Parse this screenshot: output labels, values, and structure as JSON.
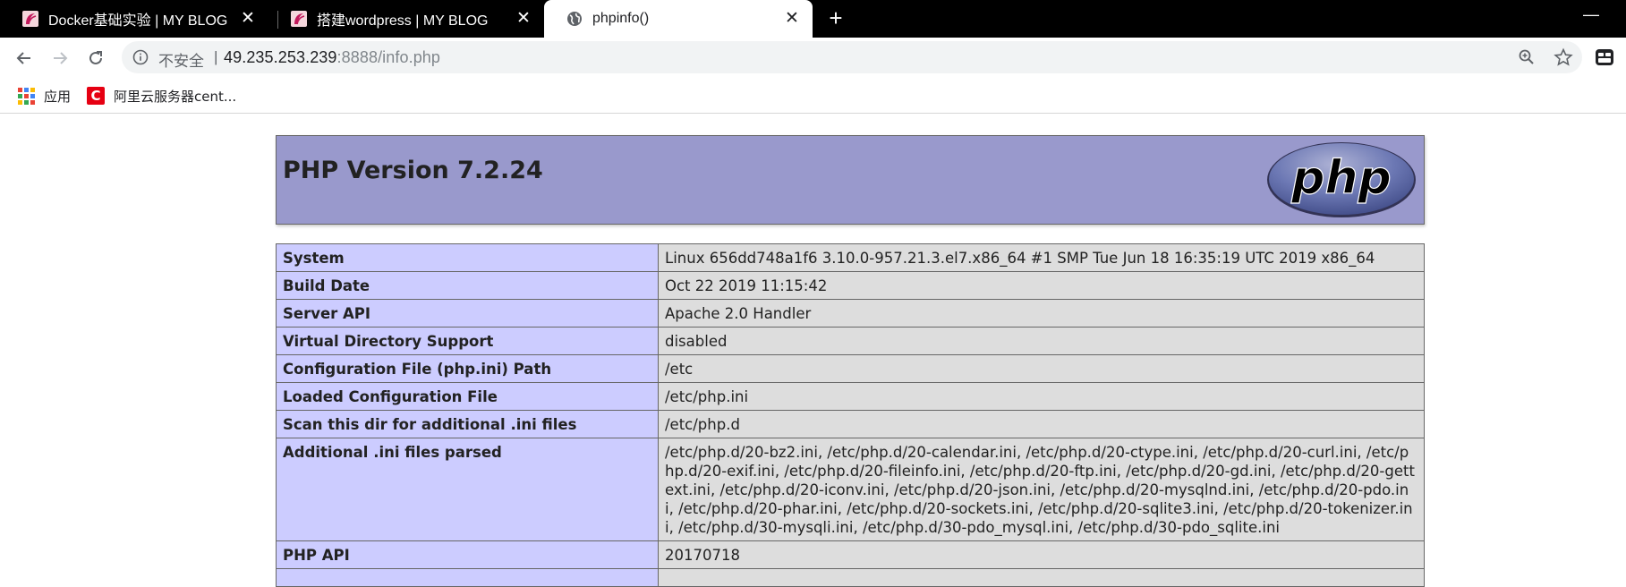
{
  "browser": {
    "tabs": [
      {
        "title": "Docker基础实验 | MY BLOG",
        "active": false,
        "icon": "blog-favicon"
      },
      {
        "title": "搭建wordpress | MY BLOG",
        "active": false,
        "icon": "blog-favicon"
      },
      {
        "title": "phpinfo()",
        "active": true,
        "icon": "globe-icon"
      }
    ],
    "new_tab_label": "+",
    "minimize_label": "—",
    "close_glyph": "✕"
  },
  "toolbar": {
    "security_label": "不安全",
    "separator": "|",
    "url_host": "49.235.253.239",
    "url_rest": ":8888/info.php"
  },
  "bookmarks": {
    "apps_label": "应用",
    "items": [
      {
        "label": "阿里云服务器cent...",
        "icon": "c-icon"
      }
    ]
  },
  "phpinfo": {
    "title": "PHP Version 7.2.24",
    "logo_text": "php",
    "rows": [
      {
        "key": "System",
        "value": "Linux 656dd748a1f6 3.10.0-957.21.3.el7.x86_64 #1 SMP Tue Jun 18 16:35:19 UTC 2019 x86_64"
      },
      {
        "key": "Build Date",
        "value": "Oct 22 2019 11:15:42"
      },
      {
        "key": "Server API",
        "value": "Apache 2.0 Handler"
      },
      {
        "key": "Virtual Directory Support",
        "value": "disabled"
      },
      {
        "key": "Configuration File (php.ini) Path",
        "value": "/etc"
      },
      {
        "key": "Loaded Configuration File",
        "value": "/etc/php.ini"
      },
      {
        "key": "Scan this dir for additional .ini files",
        "value": "/etc/php.d"
      },
      {
        "key": "Additional .ini files parsed",
        "value": "/etc/php.d/20-bz2.ini, /etc/php.d/20-calendar.ini, /etc/php.d/20-ctype.ini, /etc/php.d/20-curl.ini, /etc/php.d/20-exif.ini, /etc/php.d/20-fileinfo.ini, /etc/php.d/20-ftp.ini, /etc/php.d/20-gd.ini, /etc/php.d/20-gettext.ini, /etc/php.d/20-iconv.ini, /etc/php.d/20-json.ini, /etc/php.d/20-mysqlnd.ini, /etc/php.d/20-pdo.ini, /etc/php.d/20-phar.ini, /etc/php.d/20-sockets.ini, /etc/php.d/20-sqlite3.ini, /etc/php.d/20-tokenizer.ini, /etc/php.d/30-mysqli.ini, /etc/php.d/30-pdo_mysql.ini, /etc/php.d/30-pdo_sqlite.ini"
      },
      {
        "key": "PHP API",
        "value": "20170718"
      },
      {
        "key": "",
        "value": ""
      }
    ]
  },
  "colors": {
    "tabstrip": "#000000",
    "header_bg": "#9999cc",
    "key_cell_bg": "#ccccff",
    "value_cell_bg": "#dddddd"
  }
}
